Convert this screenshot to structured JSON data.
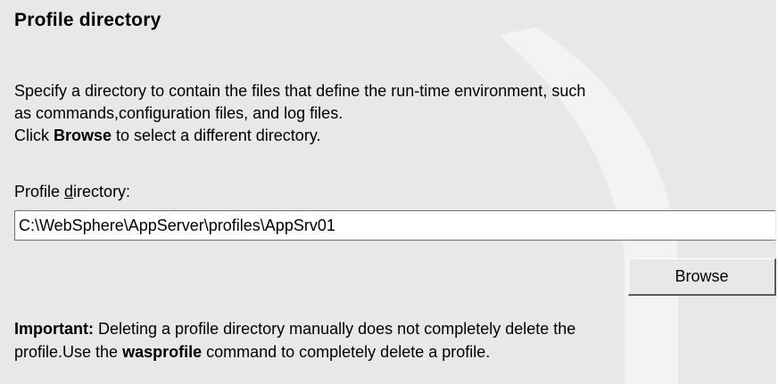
{
  "section": {
    "title": "Profile directory"
  },
  "description": {
    "line1": "Specify a directory to contain the files that define the run-time environment, such",
    "line2": "as commands,configuration files, and log files.",
    "line3_prefix": "Click ",
    "line3_bold": "Browse",
    "line3_suffix": " to select a different directory."
  },
  "field": {
    "label_prefix": "Profile ",
    "label_mnemonic": "d",
    "label_suffix": "irectory:",
    "value": "C:\\WebSphere\\AppServer\\profiles\\AppSrv01"
  },
  "buttons": {
    "browse_label": "Browse"
  },
  "note": {
    "important_label": "Important:",
    "line1_text": " Deleting a profile directory manually does not completely delete the",
    "line2_prefix": "profile.Use the ",
    "line2_bold": "wasprofile",
    "line2_suffix": " command to completely delete a profile."
  },
  "colors": {
    "panel_background": "#e8e8e6",
    "input_background": "#ffffff",
    "text": "#000000"
  }
}
